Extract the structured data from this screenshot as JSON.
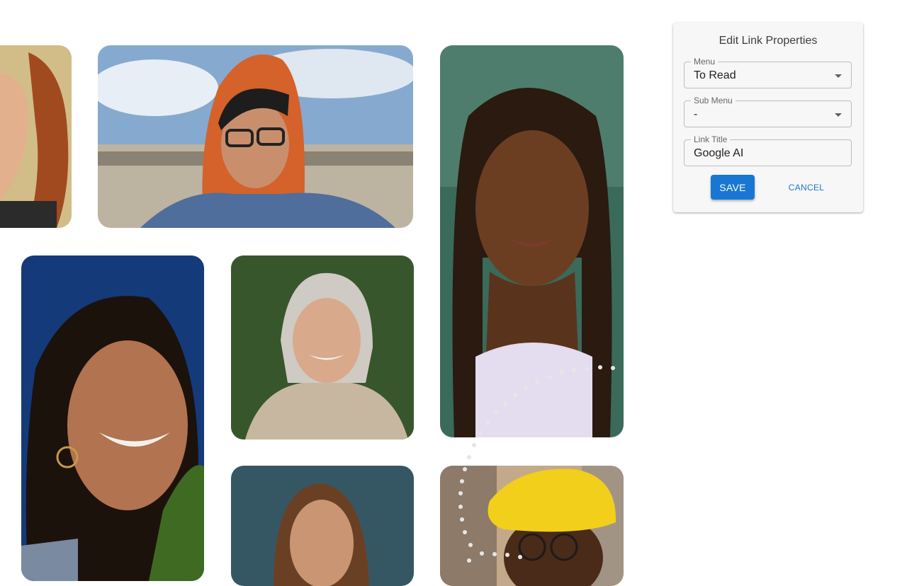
{
  "dialog": {
    "title": "Edit Link Properties",
    "menu": {
      "label": "Menu",
      "value": "To Read"
    },
    "submenu": {
      "label": "Sub Menu",
      "value": "-"
    },
    "link_title": {
      "label": "Link Title",
      "value": "Google AI"
    },
    "save_label": "SAVE",
    "cancel_label": "CANCEL"
  },
  "colors": {
    "accent": "#1976d2",
    "panel_bg": "#f7f7f7"
  }
}
